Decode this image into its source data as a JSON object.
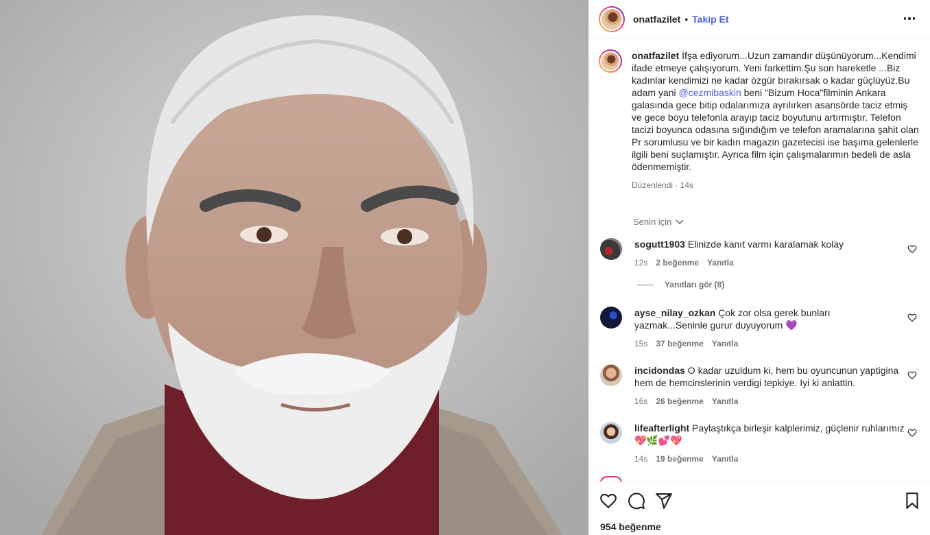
{
  "post": {
    "author": "onatfazilet",
    "separator": "•",
    "follow_label": "Takip Et",
    "caption_prefix": "İfşa ediyorum...Uzun zamandır düşünüyorum...Kendimi ifade etmeye çalışıyorum. Yeni farkettim.Şu son hareketle ...Biz kadınlar kendimizi ne kadar özgür bırakırsak o kadar güçlüyüz.Bu adam yani ",
    "caption_mention": "@cezmibaskin",
    "caption_suffix": " beni \"Bizum Hoca\"filminin Ankara galasında gece bitip odalarımıza ayrılırken asansörde taciz etmiş ve gece boyu telefonla arayıp taciz boyutunu artırmıştır. Telefon tacizi boyunca odasına sığındığım ve telefon aramalarına şahit olan Pr sorumlusu ve bir kadın magazin gazetecisi ise başıma gelenlerle ilgili beni suçlamıştır. Ayrıca film için çalışmalarımın bedeli de asla ödenmemiştir.",
    "edited_label": "Düzenlendi",
    "meta_dot": "·",
    "time": "14s",
    "filter_label": "Senin için",
    "likes_text": "954 beğenme"
  },
  "comments": [
    {
      "user": "sogutt1903",
      "text": "Elinizde kanıt varmı karalamak kolay",
      "time": "12s",
      "likes": "2 beğenme",
      "reply": "Yanıtla"
    },
    {
      "user": "ayse_nilay_ozkan",
      "text": "Çok zor olsa gerek bunları yazmak...Seninle gurur duyuyorum 💜",
      "time": "15s",
      "likes": "37 beğenme",
      "reply": "Yanıtla"
    },
    {
      "user": "incidondas",
      "text": "O kadar uzuldum ki, hem bu oyuncunun yaptigina hem de hemcinslerinin verdigi tepkiye. Iyi ki anlattin.",
      "time": "16s",
      "likes": "26 beğenme",
      "reply": "Yanıtla"
    },
    {
      "user": "lifeafterlight",
      "text": "Paylaştıkça birleşir kalplerimiz, güçlenir ruhlarımız 💖🌿💕💖",
      "time": "14s",
      "likes": "19 beğenme",
      "reply": "Yanıtla"
    }
  ],
  "replies_label": "Yanıtları gör (8)",
  "icons": [
    "more-options-icon",
    "chevron-down-icon",
    "heart-icon",
    "comment-icon",
    "share-icon",
    "bookmark-icon"
  ],
  "colors": {
    "link": "#4a5de8",
    "muted": "#737373",
    "text": "#262626",
    "ring_start": "#f9ce34",
    "ring_mid": "#ee2a7b"
  }
}
